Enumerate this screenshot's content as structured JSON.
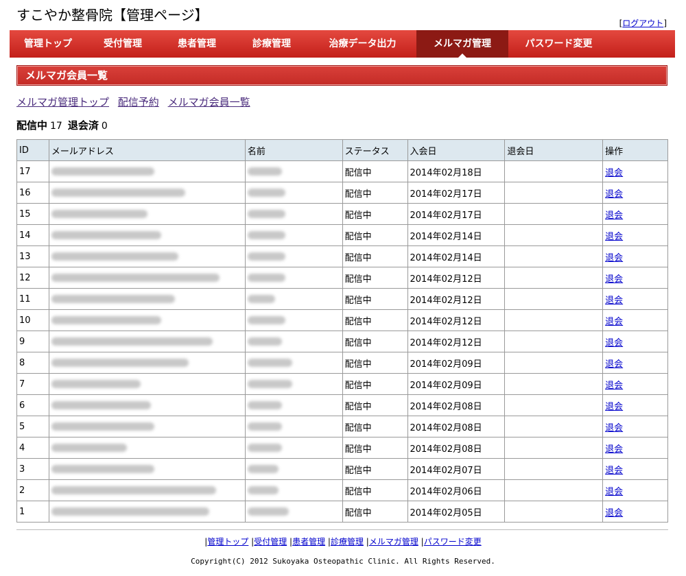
{
  "header": {
    "title": "すこやか整骨院【管理ページ】",
    "logout_prefix": "[",
    "logout_label": "ログアウト",
    "logout_suffix": "]"
  },
  "nav": {
    "items": [
      {
        "label": "管理トップ",
        "active": false
      },
      {
        "label": "受付管理",
        "active": false
      },
      {
        "label": "患者管理",
        "active": false
      },
      {
        "label": "診療管理",
        "active": false
      },
      {
        "label": "治療データ出力",
        "active": false
      },
      {
        "label": "メルマガ管理",
        "active": true
      },
      {
        "label": "パスワード変更",
        "active": false
      }
    ]
  },
  "section": {
    "title": "メルマガ会員一覧"
  },
  "sub_links": [
    "メルマガ管理トップ",
    "配信予約",
    "メルマガ会員一覧"
  ],
  "summary": {
    "active_label": "配信中",
    "active_count": "17",
    "withdrawn_label": "退会済",
    "withdrawn_count": "0"
  },
  "table": {
    "headers": [
      "ID",
      "メールアドレス",
      "名前",
      "ステータス",
      "入会日",
      "退会日",
      "操作"
    ],
    "rows": [
      {
        "id": "17",
        "status": "配信中",
        "joined": "2014年02月18日",
        "left": "",
        "action": "退会"
      },
      {
        "id": "16",
        "status": "配信中",
        "joined": "2014年02月17日",
        "left": "",
        "action": "退会"
      },
      {
        "id": "15",
        "status": "配信中",
        "joined": "2014年02月17日",
        "left": "",
        "action": "退会"
      },
      {
        "id": "14",
        "status": "配信中",
        "joined": "2014年02月14日",
        "left": "",
        "action": "退会"
      },
      {
        "id": "13",
        "status": "配信中",
        "joined": "2014年02月14日",
        "left": "",
        "action": "退会"
      },
      {
        "id": "12",
        "status": "配信中",
        "joined": "2014年02月12日",
        "left": "",
        "action": "退会"
      },
      {
        "id": "11",
        "status": "配信中",
        "joined": "2014年02月12日",
        "left": "",
        "action": "退会"
      },
      {
        "id": "10",
        "status": "配信中",
        "joined": "2014年02月12日",
        "left": "",
        "action": "退会"
      },
      {
        "id": "9",
        "status": "配信中",
        "joined": "2014年02月12日",
        "left": "",
        "action": "退会"
      },
      {
        "id": "8",
        "status": "配信中",
        "joined": "2014年02月09日",
        "left": "",
        "action": "退会"
      },
      {
        "id": "7",
        "status": "配信中",
        "joined": "2014年02月09日",
        "left": "",
        "action": "退会"
      },
      {
        "id": "6",
        "status": "配信中",
        "joined": "2014年02月08日",
        "left": "",
        "action": "退会"
      },
      {
        "id": "5",
        "status": "配信中",
        "joined": "2014年02月08日",
        "left": "",
        "action": "退会"
      },
      {
        "id": "4",
        "status": "配信中",
        "joined": "2014年02月08日",
        "left": "",
        "action": "退会"
      },
      {
        "id": "3",
        "status": "配信中",
        "joined": "2014年02月07日",
        "left": "",
        "action": "退会"
      },
      {
        "id": "2",
        "status": "配信中",
        "joined": "2014年02月06日",
        "left": "",
        "action": "退会"
      },
      {
        "id": "1",
        "status": "配信中",
        "joined": "2014年02月05日",
        "left": "",
        "action": "退会"
      }
    ]
  },
  "footer": {
    "links": [
      "管理トップ",
      "受付管理",
      "患者管理",
      "診療管理",
      "メルマガ管理",
      "パスワード変更"
    ],
    "copyright": "Copyright(C) 2012 Sukoyaka Osteopathic Clinic. All Rights Reserved."
  },
  "colors": {
    "nav_bg": "#d2322c",
    "nav_active": "#8c1a14",
    "header_row": "#dde8ef",
    "link": "#0000cc"
  }
}
